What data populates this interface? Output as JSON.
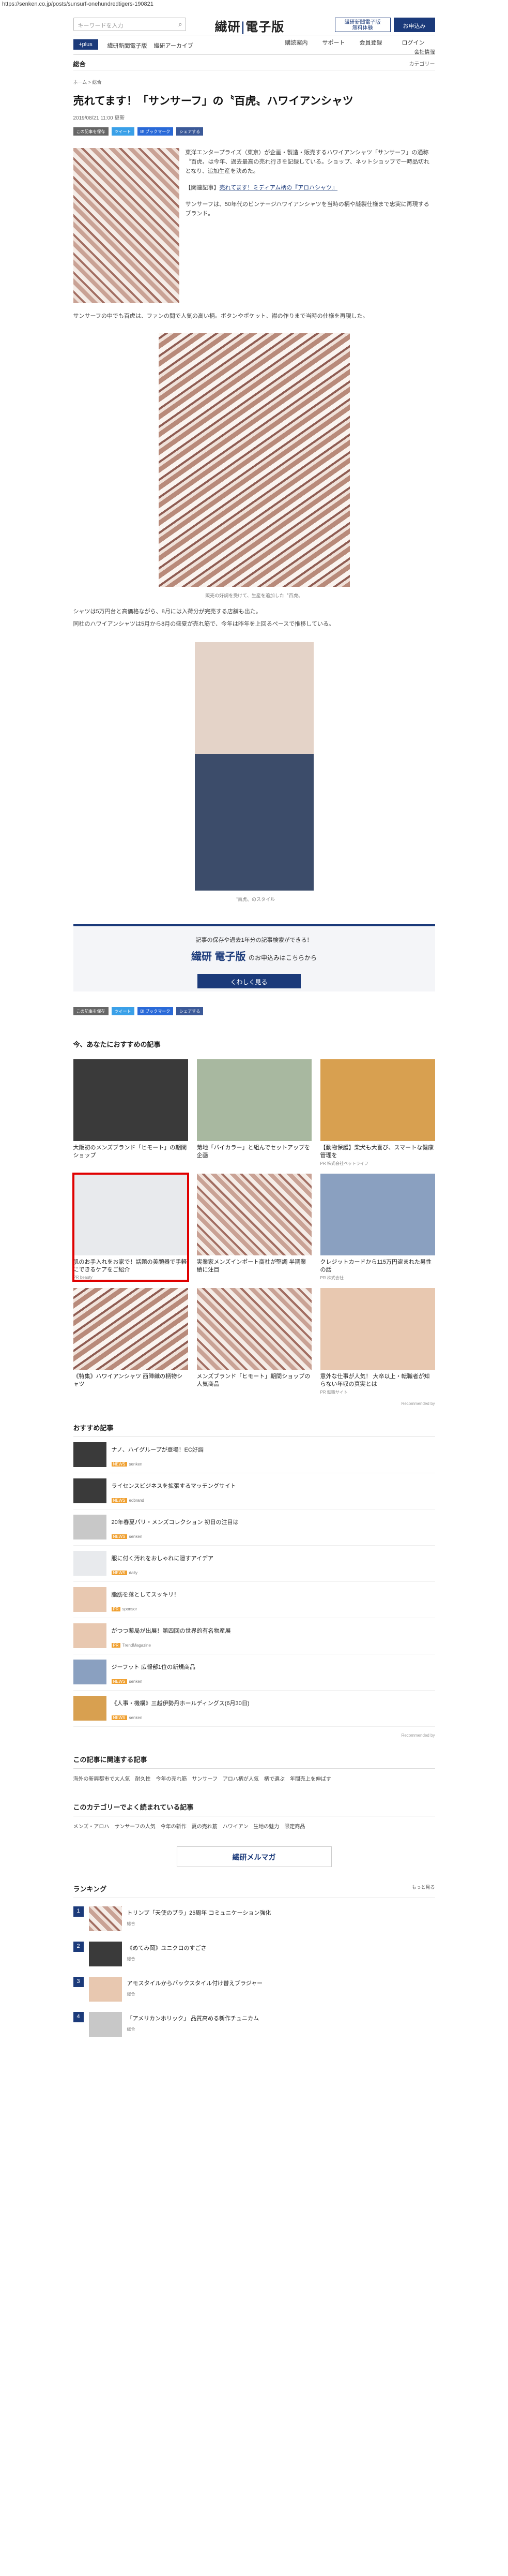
{
  "url": "https://senken.co.jp/posts/sunsurf-onehundredtigers-190821",
  "header": {
    "search_placeholder": "キーワードを入力",
    "logo_a": "繊研",
    "logo_b": "電子版",
    "btn1": "繊研新聞電子版",
    "btn1_sub": "無料体験",
    "btn2": "お申込み"
  },
  "nav": {
    "plus": "+plus",
    "items": [
      "繊研新聞電子版",
      "繊研アーカイブ",
      "購読案内",
      "サポート",
      "会員登録",
      "ログイン"
    ],
    "sub": "会社情報"
  },
  "section": {
    "title": "総合",
    "category": "カテゴリー"
  },
  "breadcrumb": "ホーム > 総合",
  "article": {
    "title": "売れてます！「サンサーフ」の〝百虎〟ハワイアンシャツ",
    "date": "2019/08/21 11:00 更新",
    "share": [
      "この記事を保存",
      "ツイート",
      "B! ブックマーク",
      "シェアする"
    ],
    "p1": "東洋エンタープライズ（東京）が企画・製造・販売するハワイアンシャツ「サンサーフ」の通称〝百虎〟は今年、過去最高の売れ行きを記録している。ショップ、ネットショップで一時品切れとなり、追加生産を決めた。",
    "p2_label": "【関連記事】",
    "p2_link": "売れてます！ミディアム柄の『アロハシャツ』",
    "p3": "サンサーフは、50年代のビンテージハワイアンシャツを当時の柄や縫製仕様まで忠実に再現するブランド。",
    "p4": "サンサーフの中でも百虎は、ファンの間で人気の高い柄。ボタンやポケット、襟の作りまで当時の仕様を再現した。",
    "cap1": "販売の好調を受けて、生産を追加した〝百虎〟",
    "p5": "シャツは5万円台と高価格ながら、8月には入荷分が完売する店舗も出た。",
    "p6": "同社のハワイアンシャツは5月から8月の盛夏が売れ筋で、今年は昨年を上回るペースで推移している。",
    "cap2": "〝百虎〟のスタイル"
  },
  "promo": {
    "line1": "記事の保存や過去1年分の記事検索ができる！",
    "logo": "繊研 電子版",
    "tail": "のお申込みはこちらから",
    "button": "くわしく見る"
  },
  "recommend": {
    "title": "今、あなたにおすすめの記事",
    "cards": [
      {
        "title": "大阪初のメンズブランド「ヒモート」の期間ショップ",
        "sponsor": ""
      },
      {
        "title": "菊地「バイカラー」と組んでセットアップを企画",
        "sponsor": ""
      },
      {
        "title": "【動物保護】柴犬も大喜び、スマートな健康管理を",
        "sponsor": "PR 株式会社ペットライフ"
      },
      {
        "title": "肌のお手入れをお家で！話題の美顔器で手軽にできるケアをご紹介",
        "sponsor": "PR beauty"
      },
      {
        "title": "実業家メンズインポート商社が堅調 半期業績に注目",
        "sponsor": ""
      },
      {
        "title": "クレジットカードから115万円盗まれた男性の話",
        "sponsor": "PR 株式会社"
      },
      {
        "title": "《特集》ハワイアンシャツ 西陣織の柄物シャツ",
        "sponsor": ""
      },
      {
        "title": "メンズブランド「ヒモート」期間ショップの人気商品",
        "sponsor": ""
      },
      {
        "title": "意外な仕事が人気！ 大卒以上・転職者が知らない年収の真実とは",
        "sponsor": "PR 転職サイト"
      }
    ],
    "footer": "Recommended by"
  },
  "osusume": {
    "title": "おすすめ記事",
    "items": [
      {
        "title": "ナノ、ハイグループが登場！EC好調",
        "src": "NEWS",
        "by": "senken"
      },
      {
        "title": "ライセンスビジネスを拡張するマッチングサイト",
        "src": "NEWS",
        "by": "edbrand"
      },
      {
        "title": "20年春夏パリ・メンズコレクション 初日の注目は",
        "src": "NEWS",
        "by": "senken"
      },
      {
        "title": "服に付く汚れをおしゃれに隠すアイデア",
        "src": "NEWS",
        "by": "daily"
      },
      {
        "title": "脂肪を落としてスッキリ！",
        "src": "PR",
        "by": "sponsor"
      },
      {
        "title": "がつつ薬局が出展！第四回の世界的有名物産展",
        "src": "PR",
        "by": "TrendMagazine"
      },
      {
        "title": "ジーフット 広報部1位の新規商品",
        "src": "NEWS",
        "by": "senken"
      },
      {
        "title": "《人事・機構》三越伊勢丹ホールディングス(6月30日)",
        "src": "NEWS",
        "by": "senken"
      }
    ],
    "footer": "Recommended by"
  },
  "related": {
    "title": "この記事に関連する記事",
    "links": [
      "海外の新興都市で大人気",
      "耐久性",
      "今年の売れ筋",
      "サンサーフ",
      "アロハ柄が人気",
      "柄で選ぶ",
      "年間売上を伸ばす"
    ]
  },
  "category_more": {
    "title": "このカテゴリーでよく読まれている記事",
    "links": [
      "メンズ・アロハ",
      "サンサーフの人気",
      "今年の新作",
      "夏の売れ筋",
      "ハワイアン",
      "生地の魅力",
      "限定商品"
    ]
  },
  "mail": {
    "label": "繊研メルマガ"
  },
  "ranking": {
    "title": "ランキング",
    "more": "もっと見る",
    "items": [
      {
        "n": "1",
        "title": "トリンプ「天使のブラ」25周年 コミュニケーション強化",
        "sub": "総合"
      },
      {
        "n": "2",
        "title": "《めてみ岡》ユニクロのすごさ",
        "sub": "総合"
      },
      {
        "n": "3",
        "title": "アモスタイルからバックスタイル付け替えブラジャー",
        "sub": "総合"
      },
      {
        "n": "4",
        "title": "「アメリカンホリック」 品質高める新作チュニカム",
        "sub": "総合"
      }
    ]
  }
}
